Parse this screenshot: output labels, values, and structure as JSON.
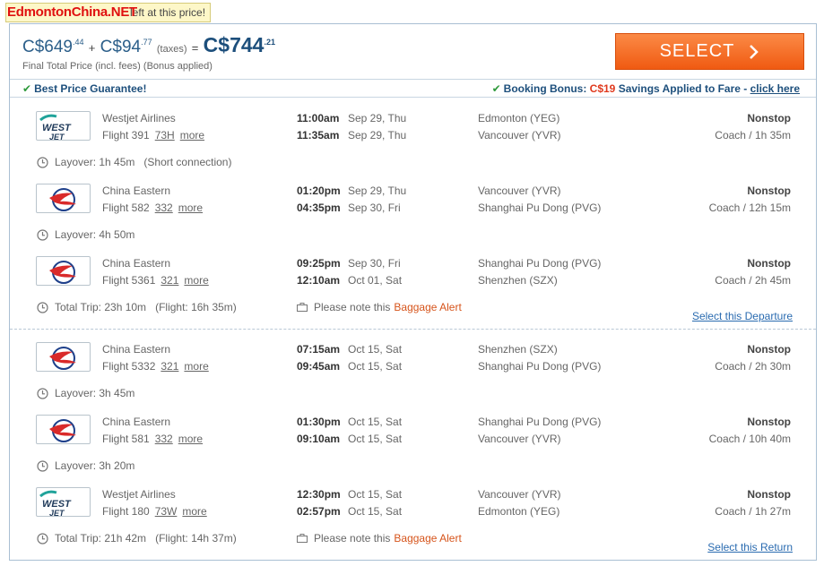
{
  "top_alert": {
    "text": "left at this price!"
  },
  "watermark": {
    "text": "EdmontonChina.NET"
  },
  "price": {
    "base_main": "C$649",
    "base_cents": ".44",
    "plus": "+",
    "tax_main": "C$94",
    "tax_cents": ".77",
    "tax_label": "(taxes)",
    "equals": "=",
    "total_main": "C$744",
    "total_cents": ".21",
    "final_note": "Final Total Price (incl. fees) (Bonus applied)"
  },
  "select_button": {
    "label": "SELECT",
    "chevron": "›"
  },
  "bonus_bar": {
    "guarantee": "Best Price Guarantee!",
    "bonus_label": "Booking Bonus:",
    "bonus_amount": "C$19",
    "bonus_text": "Savings Applied to Fare -",
    "click_here": "click here"
  },
  "legs": [
    {
      "segments": [
        {
          "airline": "Westjet Airlines",
          "logo": "westjet",
          "flight": "Flight 391",
          "aircraft": "73H",
          "more": "more",
          "dep_time": "11:00am",
          "dep_date": "Sep 29, Thu",
          "arr_time": "11:35am",
          "arr_date": "Sep 29, Thu",
          "from": "Edmonton (YEG)",
          "to": "Vancouver (YVR)",
          "stops": "Nonstop",
          "cabin": "Coach / 1h 35m"
        },
        {
          "airline": "China Eastern",
          "logo": "china-eastern",
          "flight": "Flight 582",
          "aircraft": "332",
          "more": "more",
          "dep_time": "01:20pm",
          "dep_date": "Sep 29, Thu",
          "arr_time": "04:35pm",
          "arr_date": "Sep 30, Fri",
          "from": "Vancouver (YVR)",
          "to": "Shanghai Pu Dong (PVG)",
          "stops": "Nonstop",
          "cabin": "Coach / 12h 15m"
        },
        {
          "airline": "China Eastern",
          "logo": "china-eastern",
          "flight": "Flight 5361",
          "aircraft": "321",
          "more": "more",
          "dep_time": "09:25pm",
          "dep_date": "Sep 30, Fri",
          "arr_time": "12:10am",
          "arr_date": "Oct 01, Sat",
          "from": "Shanghai Pu Dong (PVG)",
          "to": "Shenzhen (SZX)",
          "stops": "Nonstop",
          "cabin": "Coach / 2h 45m"
        }
      ],
      "layovers": [
        "Layover: 1h 45m",
        "Layover: 4h 50m"
      ],
      "layover_note": "(Short connection)",
      "total_trip": "Total Trip: 23h 10m",
      "flight_time": "(Flight: 16h 35m)",
      "baggage_note": "Please note this",
      "baggage_alert": "Baggage Alert",
      "select_link": "Select this Departure"
    },
    {
      "segments": [
        {
          "airline": "China Eastern",
          "logo": "china-eastern",
          "flight": "Flight 5332",
          "aircraft": "321",
          "more": "more",
          "dep_time": "07:15am",
          "dep_date": "Oct 15, Sat",
          "arr_time": "09:45am",
          "arr_date": "Oct 15, Sat",
          "from": "Shenzhen (SZX)",
          "to": "Shanghai Pu Dong (PVG)",
          "stops": "Nonstop",
          "cabin": "Coach / 2h 30m"
        },
        {
          "airline": "China Eastern",
          "logo": "china-eastern",
          "flight": "Flight 581",
          "aircraft": "332",
          "more": "more",
          "dep_time": "01:30pm",
          "dep_date": "Oct 15, Sat",
          "arr_time": "09:10am",
          "arr_date": "Oct 15, Sat",
          "from": "Shanghai Pu Dong (PVG)",
          "to": "Vancouver (YVR)",
          "stops": "Nonstop",
          "cabin": "Coach / 10h 40m"
        },
        {
          "airline": "Westjet Airlines",
          "logo": "westjet",
          "flight": "Flight 180",
          "aircraft": "73W",
          "more": "more",
          "dep_time": "12:30pm",
          "dep_date": "Oct 15, Sat",
          "arr_time": "02:57pm",
          "arr_date": "Oct 15, Sat",
          "from": "Vancouver (YVR)",
          "to": "Edmonton (YEG)",
          "stops": "Nonstop",
          "cabin": "Coach / 1h 27m"
        }
      ],
      "layovers": [
        "Layover: 3h 45m",
        "Layover: 3h 20m"
      ],
      "layover_note": "",
      "total_trip": "Total Trip: 21h 42m",
      "flight_time": "(Flight: 14h 37m)",
      "baggage_note": "Please note this",
      "baggage_alert": "Baggage Alert",
      "select_link": "Select this Return"
    }
  ],
  "logos": {
    "westjet_line1": "WEST",
    "westjet_line2": "JET"
  },
  "colors": {
    "accent": "#1d4f7c",
    "select_button": "#f26a22",
    "bonus_amount": "#e03a1e",
    "check": "#2e9a3b",
    "baggage_alert": "#d6541b",
    "link": "#2a6bb0"
  },
  "icons": [
    "check-icon",
    "clock-icon",
    "baggage-icon",
    "chevron-right-icon"
  ]
}
